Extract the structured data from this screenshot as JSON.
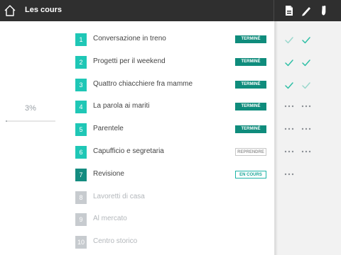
{
  "header": {
    "title": "Les cours",
    "home_icon": "home-icon",
    "tools": [
      "document-icon",
      "pencil-icon",
      "hand-icon"
    ]
  },
  "progress": {
    "percent_label": "3%",
    "percent_value": 0.03
  },
  "lessons": [
    {
      "number": "1",
      "title": "Conversazione in treno",
      "badge": "TERMINÉ",
      "state": "done",
      "marks": [
        "check-light",
        "check"
      ]
    },
    {
      "number": "2",
      "title": "Progetti per il weekend",
      "badge": "TERMINÉ",
      "state": "done",
      "marks": [
        "check",
        "check"
      ]
    },
    {
      "number": "3",
      "title": "Quattro chiacchiere fra mamme",
      "badge": "TERMINÉ",
      "state": "done",
      "marks": [
        "check",
        "check-light"
      ]
    },
    {
      "number": "4",
      "title": "La parola ai mariti",
      "badge": "TERMINÉ",
      "state": "done",
      "marks": [
        "dots",
        "dots"
      ]
    },
    {
      "number": "5",
      "title": "Parentele",
      "badge": "TERMINÉ",
      "state": "done",
      "marks": [
        "dots",
        "dots"
      ]
    },
    {
      "number": "6",
      "title": "Capufficio e segretaria",
      "badge": "REPRENDRE",
      "state": "resume",
      "marks": [
        "dots",
        "dots"
      ]
    },
    {
      "number": "7",
      "title": "Revisione",
      "badge": "EN COURS",
      "state": "current",
      "marks": [
        "dots"
      ]
    },
    {
      "number": "8",
      "title": "Lavoretti di casa",
      "badge": "",
      "state": "locked",
      "marks": []
    },
    {
      "number": "9",
      "title": "Al mercato",
      "badge": "",
      "state": "locked",
      "marks": []
    },
    {
      "number": "10",
      "title": "Centro storico",
      "badge": "",
      "state": "locked",
      "marks": []
    }
  ],
  "colors": {
    "topbar": "#2f2f2f",
    "teal": "#1fc7b6",
    "teal_dark": "#148c80",
    "badge_done": "#0f8c7c",
    "locked": "#c7cbcf",
    "check": "#2fbfa6",
    "check_light": "#9ad8cd"
  }
}
